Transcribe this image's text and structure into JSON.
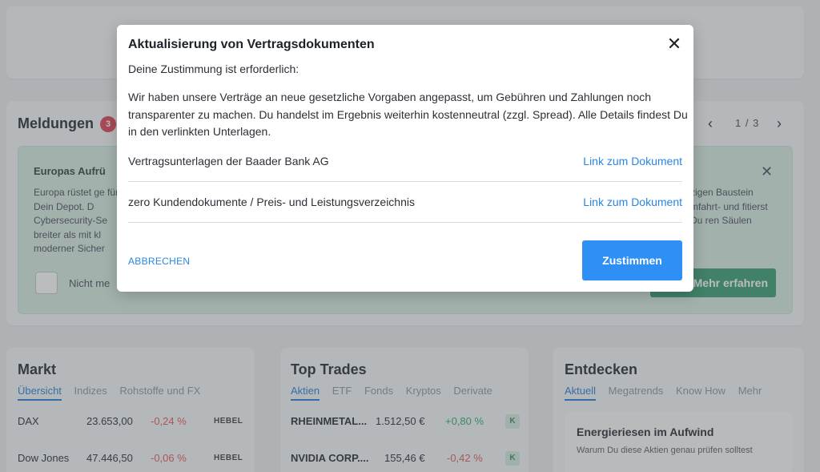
{
  "meldungen": {
    "title": "Meldungen",
    "badge": "3",
    "pager": "1 / 3",
    "card": {
      "title": "Europas Aufrü",
      "text_left": "Europa rüstet ge für Dein Depot. D Cybersecurity-Se breiter als mit kl moderner Sicher",
      "text_right": "zigen Baustein mfahrt- und fitierst Du ren Säulen",
      "checkbox_label": "Nicht me",
      "button": "Mehr erfahren"
    }
  },
  "markt": {
    "title": "Markt",
    "tabs": [
      "Übersicht",
      "Indizes",
      "Rohstoffe und FX"
    ],
    "rows": [
      {
        "name": "DAX",
        "value": "23.653,00",
        "change": "-0,24 %",
        "tag": "HEBEL"
      },
      {
        "name": "Dow Jones",
        "value": "47.446,50",
        "change": "-0,06 %",
        "tag": "HEBEL"
      }
    ]
  },
  "top_trades": {
    "title": "Top Trades",
    "tabs": [
      "Aktien",
      "ETF",
      "Fonds",
      "Kryptos",
      "Derivate"
    ],
    "rows": [
      {
        "name": "RHEINMETAL...",
        "value": "1.512,50 €",
        "change": "+0,80 %",
        "tag": "K"
      },
      {
        "name": "NVIDIA CORP....",
        "value": "155,46 €",
        "change": "-0,42 %",
        "tag": "K"
      }
    ]
  },
  "entdecken": {
    "title": "Entdecken",
    "tabs": [
      "Aktuell",
      "Megatrends",
      "Know How",
      "Mehr"
    ],
    "item_title": "Energieriesen im Aufwind",
    "item_sub": "Warum Du diese Aktien genau prüfen solltest"
  },
  "modal": {
    "title": "Aktualisierung von Vertragsdokumenten",
    "subtitle": "Deine Zustimmung ist erforderlich:",
    "body": "Wir haben unsere Verträge an neue gesetzliche Vorgaben angepasst, um Gebühren und Zahlungen noch transparenter zu machen. Du handelst im Ergebnis weiterhin kostenneutral (zzgl. Spread). Alle Details findest Du in den verlinkten Unterlagen.",
    "documents": [
      {
        "label": "Vertragsunterlagen der Baader Bank AG",
        "link": "Link zum Dokument"
      },
      {
        "label": "zero Kundendokumente / Preis- und Leistungsverzeichnis",
        "link": "Link zum Dokument"
      }
    ],
    "cancel": "ABBRECHEN",
    "agree": "Zustimmen"
  }
}
